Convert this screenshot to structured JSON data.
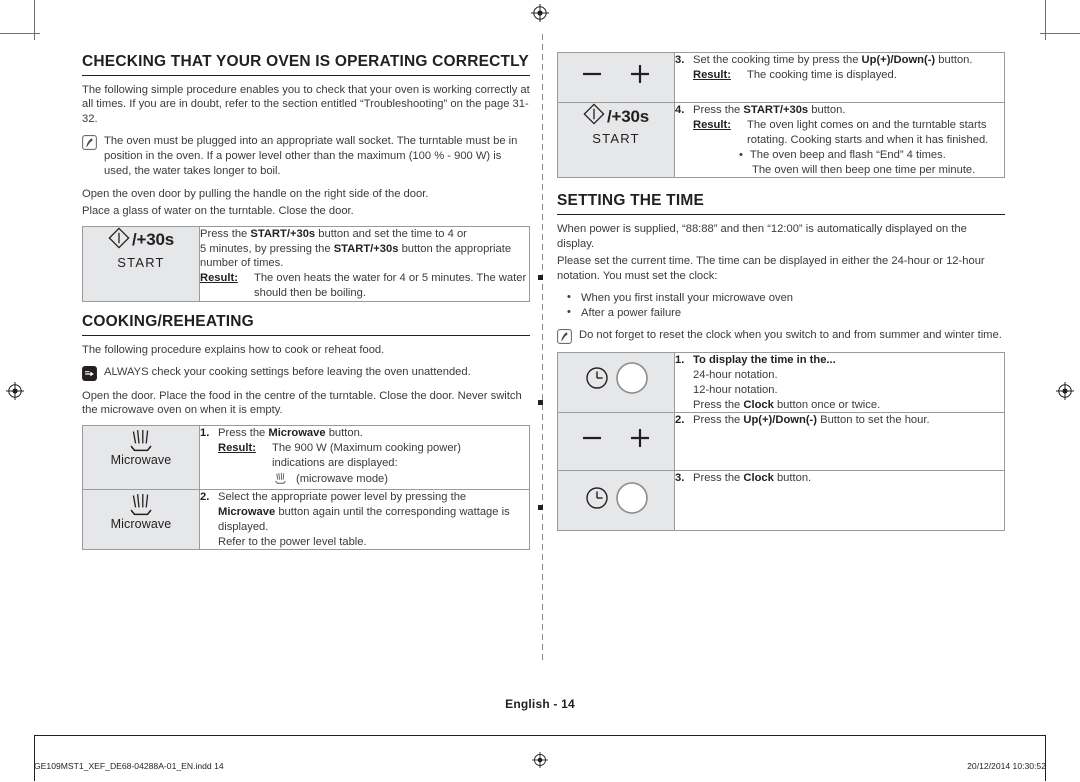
{
  "page": {
    "number_label": "English - 14",
    "footer_left": "GE109MST1_XEF_DE68-04288A-01_EN.indd   14",
    "footer_date": "20/12/2014   10:30:52"
  },
  "left_column": {
    "section1": {
      "heading": "CHECKING THAT YOUR OVEN IS OPERATING CORRECTLY",
      "intro": "The following simple procedure enables you to check that your oven is working correctly at all times. If you are in doubt, refer to the section entitled “Troubleshooting” on the page 31-32.",
      "note": "The oven must be plugged into an appropriate wall socket. The turntable must be in position in the oven. If a power level other than the maximum (100 % - 900 W) is used, the water takes longer to boil.",
      "para_line1": "Open the oven door by pulling the handle on the right side of the door.",
      "para_line2": "Place a glass of water on the turntable. Close the door.",
      "table": {
        "key_symbol": "/+30s",
        "key_label": "START",
        "text_line1_a": "Press the ",
        "text_line1_b": "START/+30s",
        "text_line1_c": " button and set the time to 4 or",
        "text_line2_a": "5 minutes, by pressing the ",
        "text_line2_b": "START/+30s",
        "text_line2_c": " button the appropriate",
        "text_line3": "number of times.",
        "result_label": "Result:",
        "result_text": "The oven heats the water for 4 or 5 minutes. The water should then be boiling."
      }
    },
    "section2": {
      "heading": "COOKING/REHEATING",
      "intro": "The following procedure explains how to cook or reheat food.",
      "note": "ALWAYS check your cooking settings before leaving the oven unattended.",
      "para": "Open the door. Place the food in the centre of the turntable. Close the door. Never switch the microwave oven on when it is empty.",
      "rows": [
        {
          "key_label": "Microwave",
          "num": "1.",
          "line1_a": "Press the ",
          "line1_b": "Microwave",
          "line1_c": " button.",
          "result_label": "Result:",
          "result_line1": "The 900 W (Maximum cooking power)",
          "result_line2": "indications are displayed:",
          "result_line3": "(microwave mode)"
        },
        {
          "key_label": "Microwave",
          "num": "2.",
          "line1": "Select the appropriate power level by pressing the",
          "line2_a": "Microwave",
          "line2_b": " button again until the corresponding wattage is",
          "line3": "displayed.",
          "line4": "Refer to the power level table."
        }
      ]
    }
  },
  "right_column": {
    "table_top": {
      "rows": [
        {
          "key": "minus-plus",
          "num": "3.",
          "line1_a": "Set the cooking time by press the ",
          "line1_b": "Up(+)/Down(-)",
          "line1_c": " button.",
          "result_label": "Result:",
          "result_text": "The cooking time is displayed."
        },
        {
          "key_symbol": "/+30s",
          "key_label": "START",
          "num": "4.",
          "line1_a": "Press the ",
          "line1_b": "START/+30s",
          "line1_c": " button.",
          "result_label": "Result:",
          "result_line1": "The oven light comes on and the turntable starts",
          "result_line2": "rotating. Cooking starts and when it has finished.",
          "bullet1": "The oven beep and flash “End” 4 times.",
          "bullet1_cont": "The oven will then beep one time per minute."
        }
      ]
    },
    "section": {
      "heading": "SETTING THE TIME",
      "para1": "When power is supplied, “88:88” and then “12:00” is automatically displayed on the display.",
      "para2": "Please set the current time. The time can be displayed in either the 24-hour or 12-hour notation. You must set the clock:",
      "bullets": [
        "When you first install your microwave oven",
        "After a power failure"
      ],
      "note": "Do not forget to reset the clock when you switch to and from summer and winter time."
    },
    "table_bottom": {
      "rows": [
        {
          "key": "clock",
          "num": "1.",
          "title": "To display the time in the...",
          "line1": "24-hour notation.",
          "line2": "12-hour notation.",
          "line3_a": "Press the ",
          "line3_b": "Clock",
          "line3_c": " button once or twice."
        },
        {
          "key": "minus-plus",
          "num": "2.",
          "line1_a": "Press the ",
          "line1_b": "Up(+)/Down(-)",
          "line1_c": " Button to set the hour."
        },
        {
          "key": "clock",
          "num": "3.",
          "line1_a": "Press the ",
          "line1_b": "Clock",
          "line1_c": " button."
        }
      ]
    }
  },
  "icons": {
    "note": "note-pen-icon",
    "warning": "pointing-hand-icon",
    "microwave": "microwave-wave-icon",
    "start": "start-diamond-icon",
    "minus": "minus-icon",
    "plus": "plus-icon",
    "clock": "clock-icon",
    "registration": "registration-mark"
  },
  "colors": {
    "text": "#231f20",
    "body_text": "#3b3b3b",
    "cell_bg": "#e6e7e8",
    "border": "#9b9b9b"
  }
}
